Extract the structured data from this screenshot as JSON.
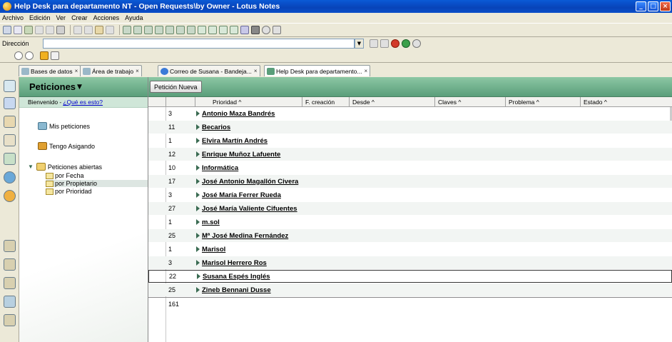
{
  "window": {
    "title": "Help Desk para departamento NT - Open Requests\\by Owner - Lotus Notes"
  },
  "menu": {
    "items": [
      "Archivo",
      "Edición",
      "Ver",
      "Crear",
      "Acciones",
      "Ayuda"
    ]
  },
  "address": {
    "label": "Dirección"
  },
  "tabs": [
    {
      "label": "Bases de datos"
    },
    {
      "label": "Área de trabajo"
    },
    {
      "label": "Correo de Susana - Bandeja..."
    },
    {
      "label": "Help Desk para departamento..."
    }
  ],
  "nav": {
    "title": "Peticiones",
    "welcome": "Bienvenido -",
    "welcome_link": "¿Qué es esto?",
    "items": {
      "mine": "Mis peticiones",
      "assigned": "Tengo Asigando",
      "open": "Peticiones abiertas",
      "by_date": "por Fecha",
      "by_owner": "por Propietario",
      "by_priority": "por Prioridad"
    }
  },
  "view": {
    "new_request": "Petición Nueva",
    "columns": {
      "priority": "Prioridad ^",
      "created": "F. creación",
      "from": "Desde ^",
      "keys": "Claves ^",
      "problem": "Problema ^",
      "status": "Estado ^"
    },
    "rows": [
      {
        "count": "3",
        "name": "Antonio Maza Bandrés"
      },
      {
        "count": "11",
        "name": "Becarios"
      },
      {
        "count": "1",
        "name": "Elvira Martín Andrés"
      },
      {
        "count": "12",
        "name": "Enrique Muñoz Lafuente"
      },
      {
        "count": "10",
        "name": "Informática"
      },
      {
        "count": "17",
        "name": "José Antonio Magallón Civera"
      },
      {
        "count": "3",
        "name": "José María Ferrer Rueda"
      },
      {
        "count": "27",
        "name": "José María Valiente Cifuentes"
      },
      {
        "count": "1",
        "name": "m.sol"
      },
      {
        "count": "25",
        "name": "Mª José Medina Fernández"
      },
      {
        "count": "1",
        "name": "Marisol"
      },
      {
        "count": "3",
        "name": "Marisol Herrero Ros"
      },
      {
        "count": "22",
        "name": "Susana Espés Inglés"
      },
      {
        "count": "25",
        "name": "Zineb Bennani Dusse"
      }
    ],
    "total": "161"
  },
  "colors": {
    "title_bar": "#0843b8",
    "nav_header": "#6fb08b",
    "accent_link": "#0000cc"
  }
}
